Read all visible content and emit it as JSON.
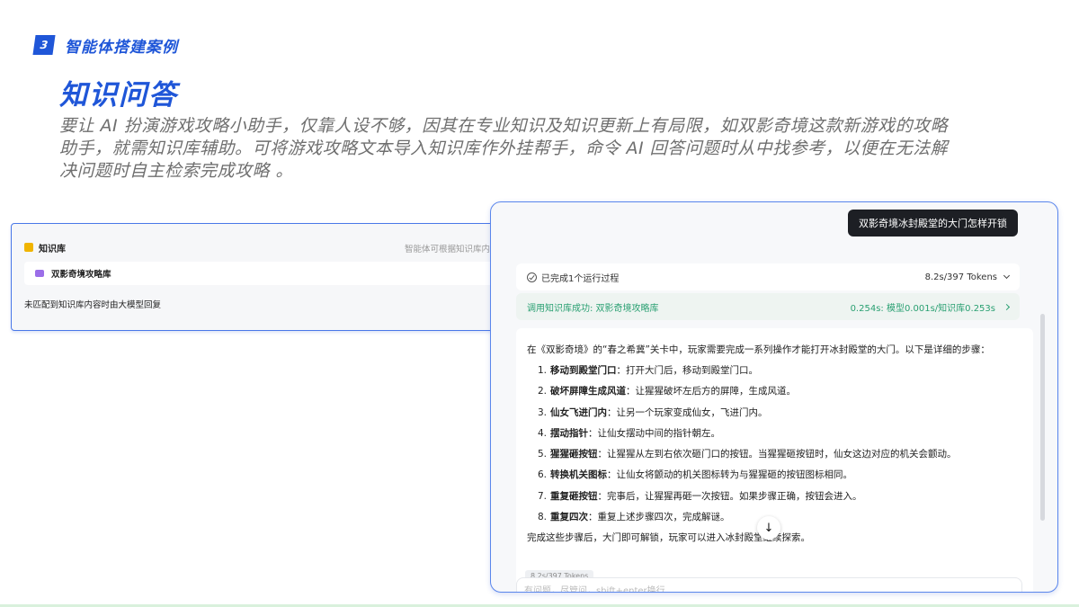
{
  "section": {
    "number": "3",
    "title": "智能体搭建案例"
  },
  "page": {
    "title": "知识问答",
    "desc_lines": [
      "要让 AI 扮演游戏攻略小助手，仅靠人设不够，因其在专业知识及知识更新上有局限，如双影奇境这款新游戏的攻略",
      "助手，就需知识库辅助。可将游戏攻略文本导入知识库作外挂帮手，命令 AI 回答问题时从中找参考，以便在无法解",
      "决问题时自主检索完成攻略 。"
    ]
  },
  "knowledge_base": {
    "title": "知识库",
    "hint": "智能体可根据知识库内容",
    "item_label": "双影奇境攻略库",
    "fallback": "未匹配到知识库内容时由大模型回复"
  },
  "chat": {
    "user_question": "双影奇境冰封殿堂的大门怎样开锁",
    "process_label": "已完成1个运行过程",
    "process_stats": "8.2s/397 Tokens",
    "kb_call_label": "调用知识库成功: 双影奇境攻略库",
    "kb_call_stats": "0.254s: 模型0.001s/知识库0.253s",
    "answer_intro": "在《双影奇境》的“春之希冀”关卡中，玩家需要完成一系列操作才能打开冰封殿堂的大门。以下是详细的步骤：",
    "steps": [
      {
        "num": "1.",
        "name": "移动到殿堂门口",
        "text": "：打开大门后，移动到殿堂门口。"
      },
      {
        "num": "2.",
        "name": "破坏屏障生成风道",
        "text": "：让猩猩破坏左后方的屏障，生成风道。"
      },
      {
        "num": "3.",
        "name": "仙女飞进门内",
        "text": "：让另一个玩家变成仙女，飞进门内。"
      },
      {
        "num": "4.",
        "name": "摆动指针",
        "text": "：让仙女摆动中间的指针朝左。"
      },
      {
        "num": "5.",
        "name": "猩猩砸按钮",
        "text": "：让猩猩从左到右依次砸门口的按钮。当猩猩砸按钮时，仙女这边对应的机关会颤动。"
      },
      {
        "num": "6.",
        "name": "转换机关图标",
        "text": "：让仙女将颤动的机关图标转为与猩猩砸的按钮图标相同。"
      },
      {
        "num": "7.",
        "name": "重复砸按钮",
        "text": "：完事后，让猩猩再砸一次按钮。如果步骤正确，按钮会进入。"
      },
      {
        "num": "8.",
        "name": "重复四次",
        "text": "：重复上述步骤四次，完成解谜。"
      }
    ],
    "answer_outro": "完成这些步骤后，大门即可解锁，玩家可以进入冰封殿堂继续探索。",
    "token_tag": "8.2s/397 Tokens",
    "input_placeholder": "有问题，尽管问，shift+enter换行",
    "scroll_icon": "arrow-down-icon"
  }
}
